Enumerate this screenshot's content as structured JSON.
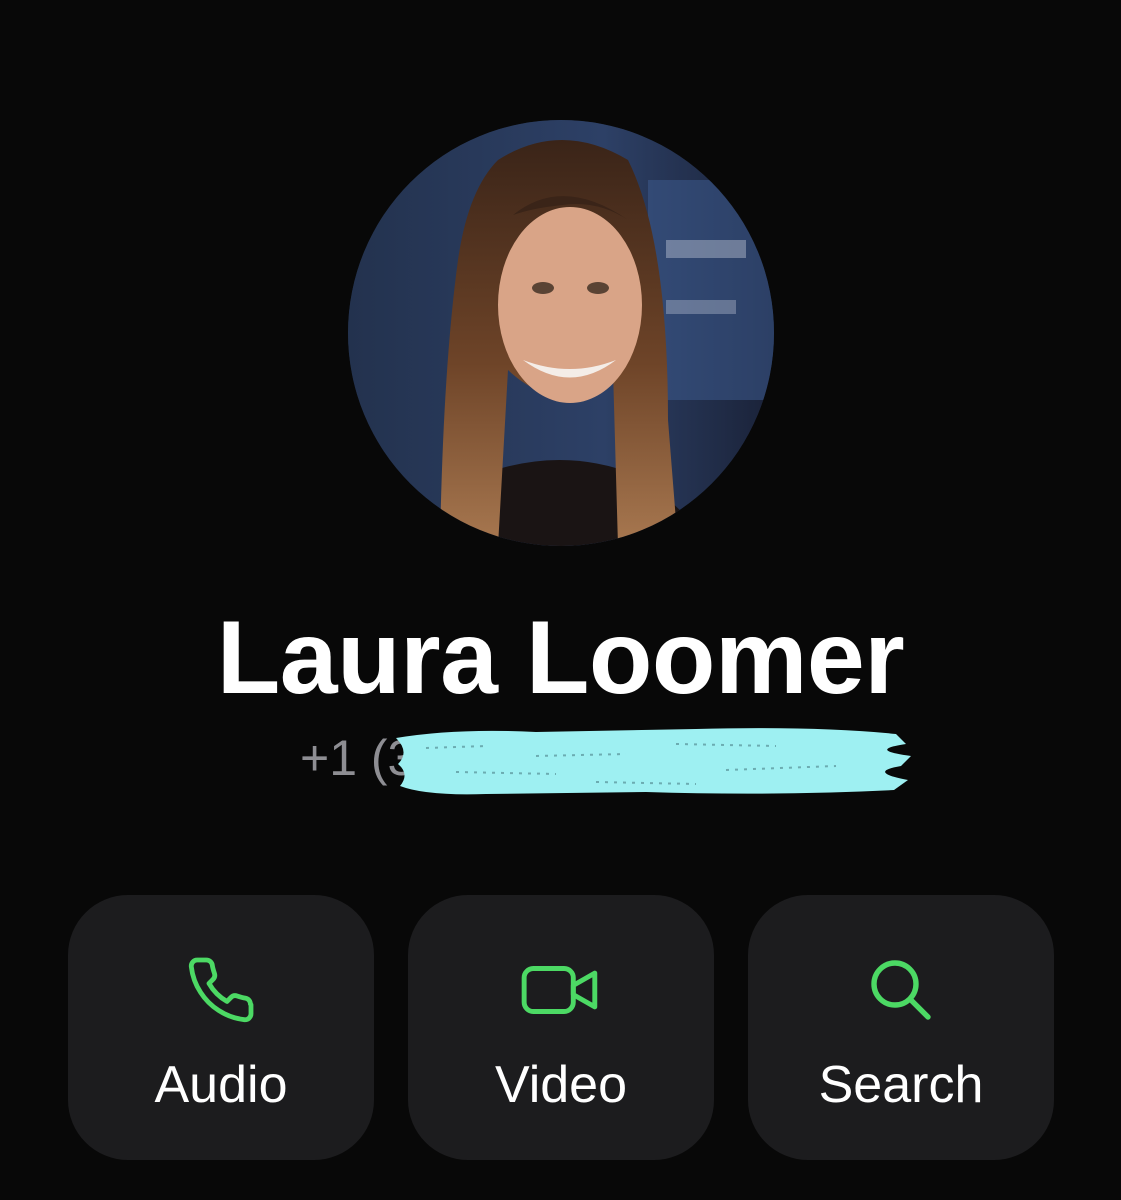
{
  "contact": {
    "name": "Laura Loomer",
    "phone_visible": "+1 (3",
    "avatar": "profile-photo"
  },
  "actions": [
    {
      "label": "Audio",
      "icon": "phone-icon"
    },
    {
      "label": "Video",
      "icon": "video-camera-icon"
    },
    {
      "label": "Search",
      "icon": "search-icon"
    }
  ],
  "colors": {
    "background": "#080808",
    "button_background": "#1c1c1e",
    "icon_accent": "#4cd964",
    "secondary_text": "#8e8e93",
    "redaction": "#9ef0f2"
  }
}
